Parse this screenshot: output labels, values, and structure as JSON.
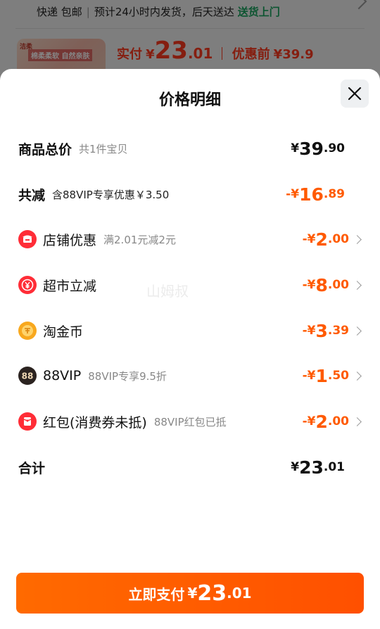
{
  "background": {
    "shipping": {
      "method": "快递 包邮",
      "eta": "预计24小时内发货，后天送达",
      "badge": "送货上门"
    },
    "product": {
      "thumb_brand": "洁柔",
      "thumb_text": "棉柔柔软 自然亲肤",
      "paid_label": "实付",
      "currency": "¥",
      "paid_int": "23",
      "paid_dec": ".01",
      "before_label": "优惠前",
      "before_price": "¥39.9"
    }
  },
  "sheet": {
    "title": "价格明细",
    "close_icon": "close-icon",
    "watermark": "山姆叔",
    "rows": [
      {
        "label": "商品总价",
        "sub": "共1件宝贝",
        "sign": "",
        "cur": "¥",
        "int": "39",
        "dec": ".90",
        "color": "#111111"
      },
      {
        "label": "共减",
        "sub": "含88VIP专享优惠￥3.50",
        "sign": "-",
        "cur": "¥",
        "int": "16",
        "dec": ".89",
        "color": "#ff5a00"
      },
      {
        "label": "店铺优惠",
        "sub": "满2.01元减2元",
        "sign": "-",
        "cur": "¥",
        "int": "2",
        "dec": ".00",
        "icon": "shop-icon",
        "icon_color": "#ff2d37"
      },
      {
        "label": "超市立减",
        "sub": "",
        "sign": "-",
        "cur": "¥",
        "int": "8",
        "dec": ".00",
        "icon": "yen-icon",
        "icon_color": "#ff2d37"
      },
      {
        "label": "淘金币",
        "sub": "",
        "sign": "-",
        "cur": "¥",
        "int": "3",
        "dec": ".39",
        "icon": "coin-icon",
        "icon_color": "#f8a81e"
      },
      {
        "label": "88VIP",
        "sub": "88VIP专享9.5折",
        "sign": "-",
        "cur": "¥",
        "int": "1",
        "dec": ".50",
        "icon": "vip88-icon",
        "icon_color": "#2b2320"
      },
      {
        "label": "红包(消费券未抵)",
        "sub": "88VIP红包已抵",
        "sign": "-",
        "cur": "¥",
        "int": "2",
        "dec": ".00",
        "icon": "red-packet-icon",
        "icon_color": "#ff2d37"
      },
      {
        "label": "合计",
        "sub": "",
        "sign": "",
        "cur": "¥",
        "int": "23",
        "dec": ".01",
        "color": "#111111"
      }
    ],
    "pay_button": {
      "label": "立即支付",
      "cur": "¥",
      "int": "23",
      "dec": ".01",
      "color": "#ff5a00"
    }
  }
}
